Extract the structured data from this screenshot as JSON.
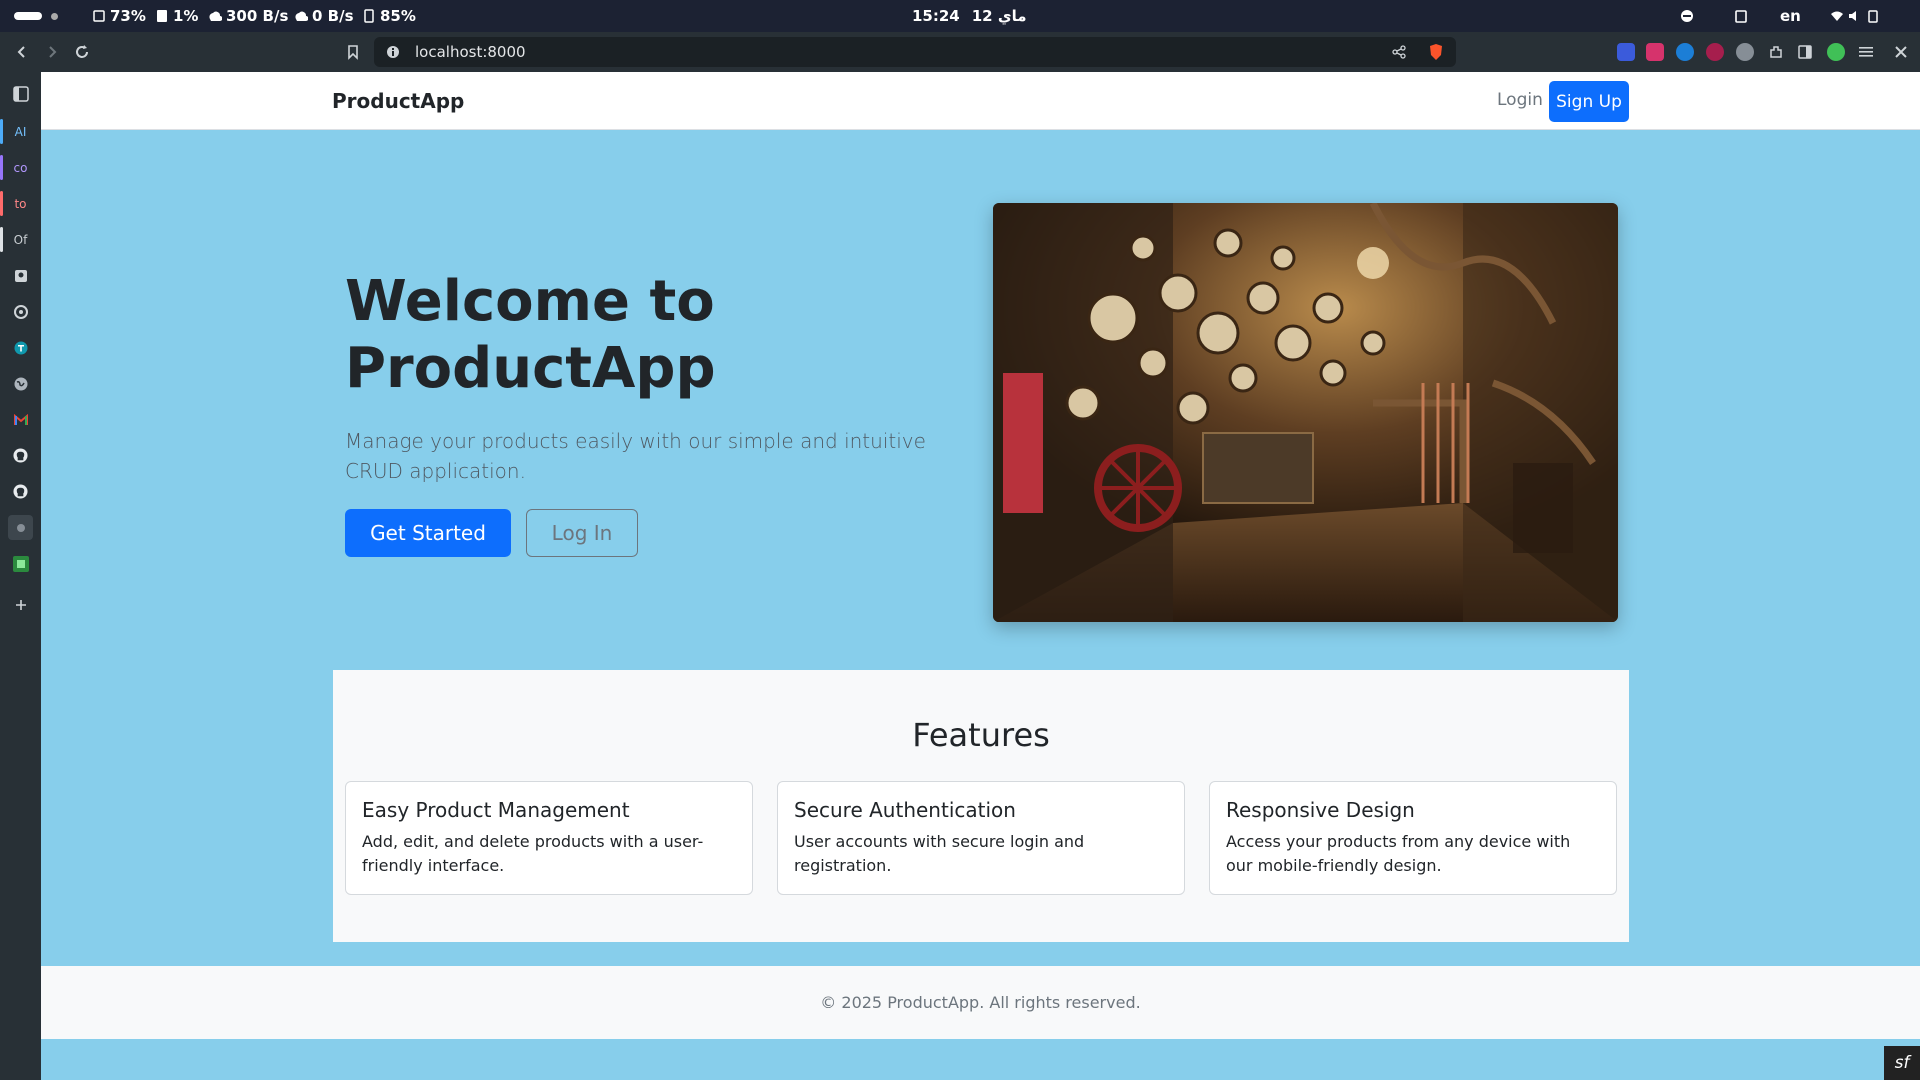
{
  "os_bar": {
    "cpu": "73%",
    "disk": "1%",
    "upload": "300 B/s",
    "download": "0 B/s",
    "memory": "85%",
    "clock": "15:24",
    "date": "12 ماي",
    "lang": "en"
  },
  "browser": {
    "url": "localhost:8000",
    "sidebar_items": [
      "AI",
      "co",
      "to",
      "Of"
    ]
  },
  "navbar": {
    "brand": "ProductApp",
    "login": "Login",
    "signup": "Sign Up"
  },
  "hero": {
    "title_line1": "Welcome to",
    "title_line2": "ProductApp",
    "subtitle": "Manage your products easily with our simple and intuitive CRUD application.",
    "primary_button": "Get Started",
    "secondary_button": "Log In"
  },
  "features": {
    "title": "Features",
    "cards": [
      {
        "title": "Easy Product Management",
        "text": "Add, edit, and delete products with a user-friendly interface."
      },
      {
        "title": "Secure Authentication",
        "text": "User accounts with secure login and registration."
      },
      {
        "title": "Responsive Design",
        "text": "Access your products from any device with our mobile-friendly design."
      }
    ]
  },
  "footer": {
    "text": "© 2025 ProductApp. All rights reserved."
  },
  "icons": [
    "battery-icon",
    "cpu-icon",
    "disk-icon",
    "upload-icon",
    "download-icon",
    "memory-icon",
    "wifi-icon",
    "volume-icon",
    "clipboard-icon",
    "back-icon",
    "forward-icon",
    "reload-icon",
    "bookmark-icon",
    "info-icon",
    "share-icon",
    "brave-lion-icon",
    "extensions-icon",
    "sidebar-toggle-icon",
    "menu-icon",
    "close-icon",
    "github-icon",
    "gmail-icon",
    "add-icon",
    "symfony-icon"
  ],
  "colors": {
    "page_bg": "#87ceeb",
    "primary": "#0d6efd",
    "toolbar": "#283036",
    "os_bar": "#1c2233"
  }
}
